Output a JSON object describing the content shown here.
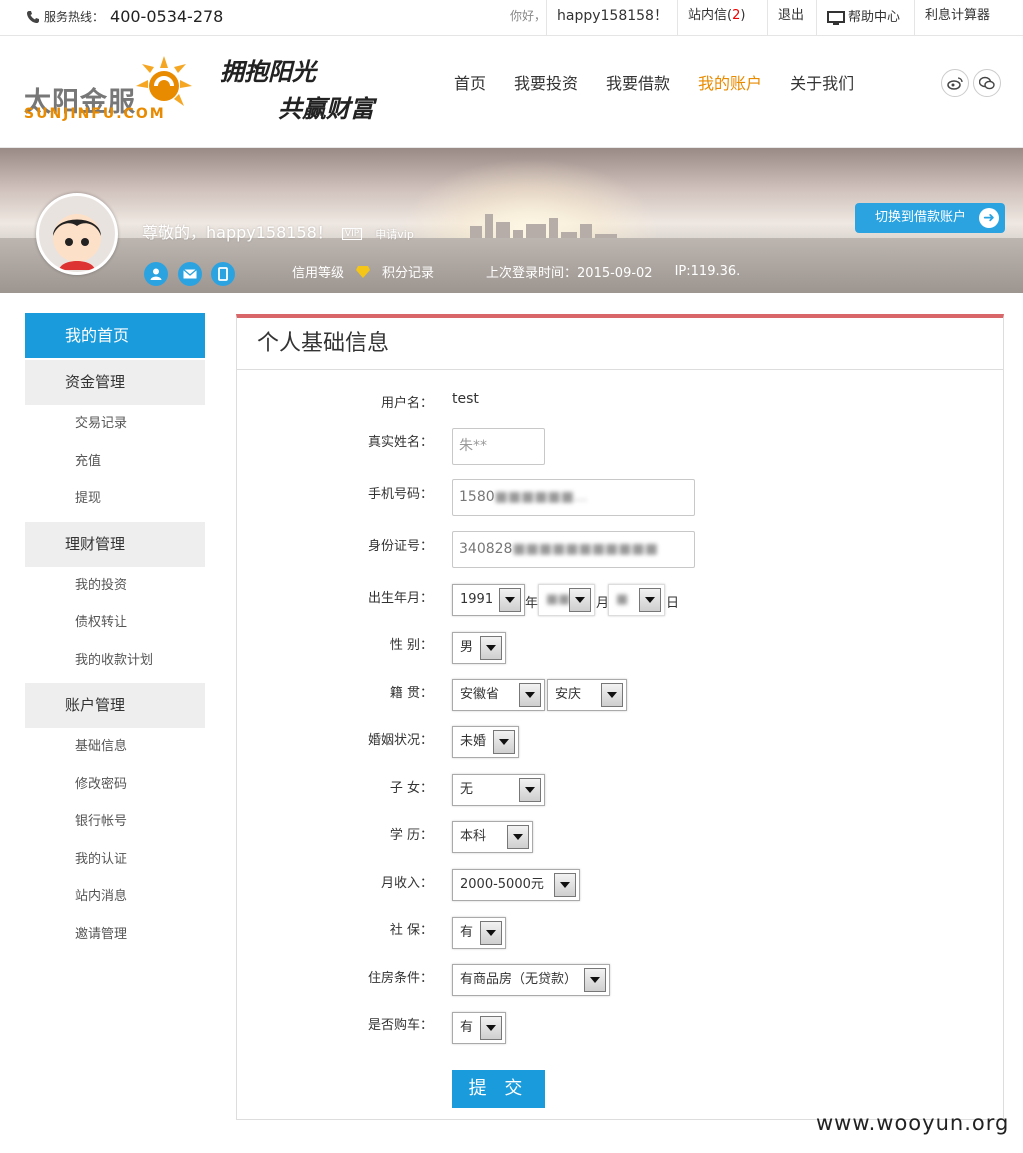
{
  "topbar": {
    "hotline_label": "服务热线：",
    "hotline_number": "400-0534-278",
    "hello": "你好，",
    "username": "happy158158！",
    "messages_label": "站内信(",
    "messages_count": "2",
    "messages_close": ")",
    "logout": "退出",
    "help": "帮助中心",
    "calculator": "利息计算器"
  },
  "header": {
    "logo_cn": "太阳金服",
    "logo_en": "SUNJINFU.COM",
    "slogan_line1": "拥抱阳光",
    "slogan_line2": "共赢财富",
    "nav": [
      "首页",
      "我要投资",
      "我要借款",
      "我的账户",
      "关于我们"
    ],
    "nav_active": "我的账户",
    "accent_color": "#e98b00"
  },
  "banner": {
    "greeting": "尊敬的，happy158158！",
    "vip": "VIP",
    "apply_vip": "申请vip",
    "credit": "信用等级",
    "points": "积分记录",
    "last_login": "上次登录时间：2015-09-02",
    "ip": "IP:119.36.",
    "switch_button": "切换到借款账户"
  },
  "sidebar": {
    "home": "我的首页",
    "sections": [
      {
        "title": "资金管理",
        "items": [
          "交易记录",
          "充值",
          "提现"
        ]
      },
      {
        "title": "理财管理",
        "items": [
          "我的投资",
          "债权转让",
          "我的收款计划"
        ]
      },
      {
        "title": "账户管理",
        "items": [
          "基础信息",
          "修改密码",
          "银行帐号",
          "我的认证",
          "站内消息",
          "邀请管理"
        ]
      }
    ],
    "accent_color": "#1a9bdc"
  },
  "form": {
    "title": "个人基础信息",
    "username_label": "用户名：",
    "username_value": "test",
    "realname_label": "真实姓名：",
    "realname_value": "朱**",
    "phone_label": "手机号码：",
    "phone_value": "1580",
    "idcard_label": "身份证号：",
    "idcard_value": "340828",
    "birth_label": "出生年月：",
    "birth_year": "1991",
    "birth_year_unit": "年",
    "birth_month_unit": "月",
    "birth_day_unit": "日",
    "gender_label": "性 别：",
    "gender_value": "男",
    "native_label": "籍 贯：",
    "province_value": "安徽省",
    "city_value": "安庆",
    "marriage_label": "婚姻状况：",
    "marriage_value": "未婚",
    "children_label": "子 女：",
    "children_value": "无",
    "education_label": "学 历：",
    "education_value": "本科",
    "income_label": "月收入：",
    "income_value": "2000-5000元",
    "insurance_label": "社 保：",
    "insurance_value": "有",
    "housing_label": "住房条件：",
    "housing_value": "有商品房（无贷款）",
    "car_label": "是否购车：",
    "car_value": "有",
    "submit": "提 交",
    "top_border_color": "#d9676a"
  },
  "watermark": "www.wooyun.org"
}
